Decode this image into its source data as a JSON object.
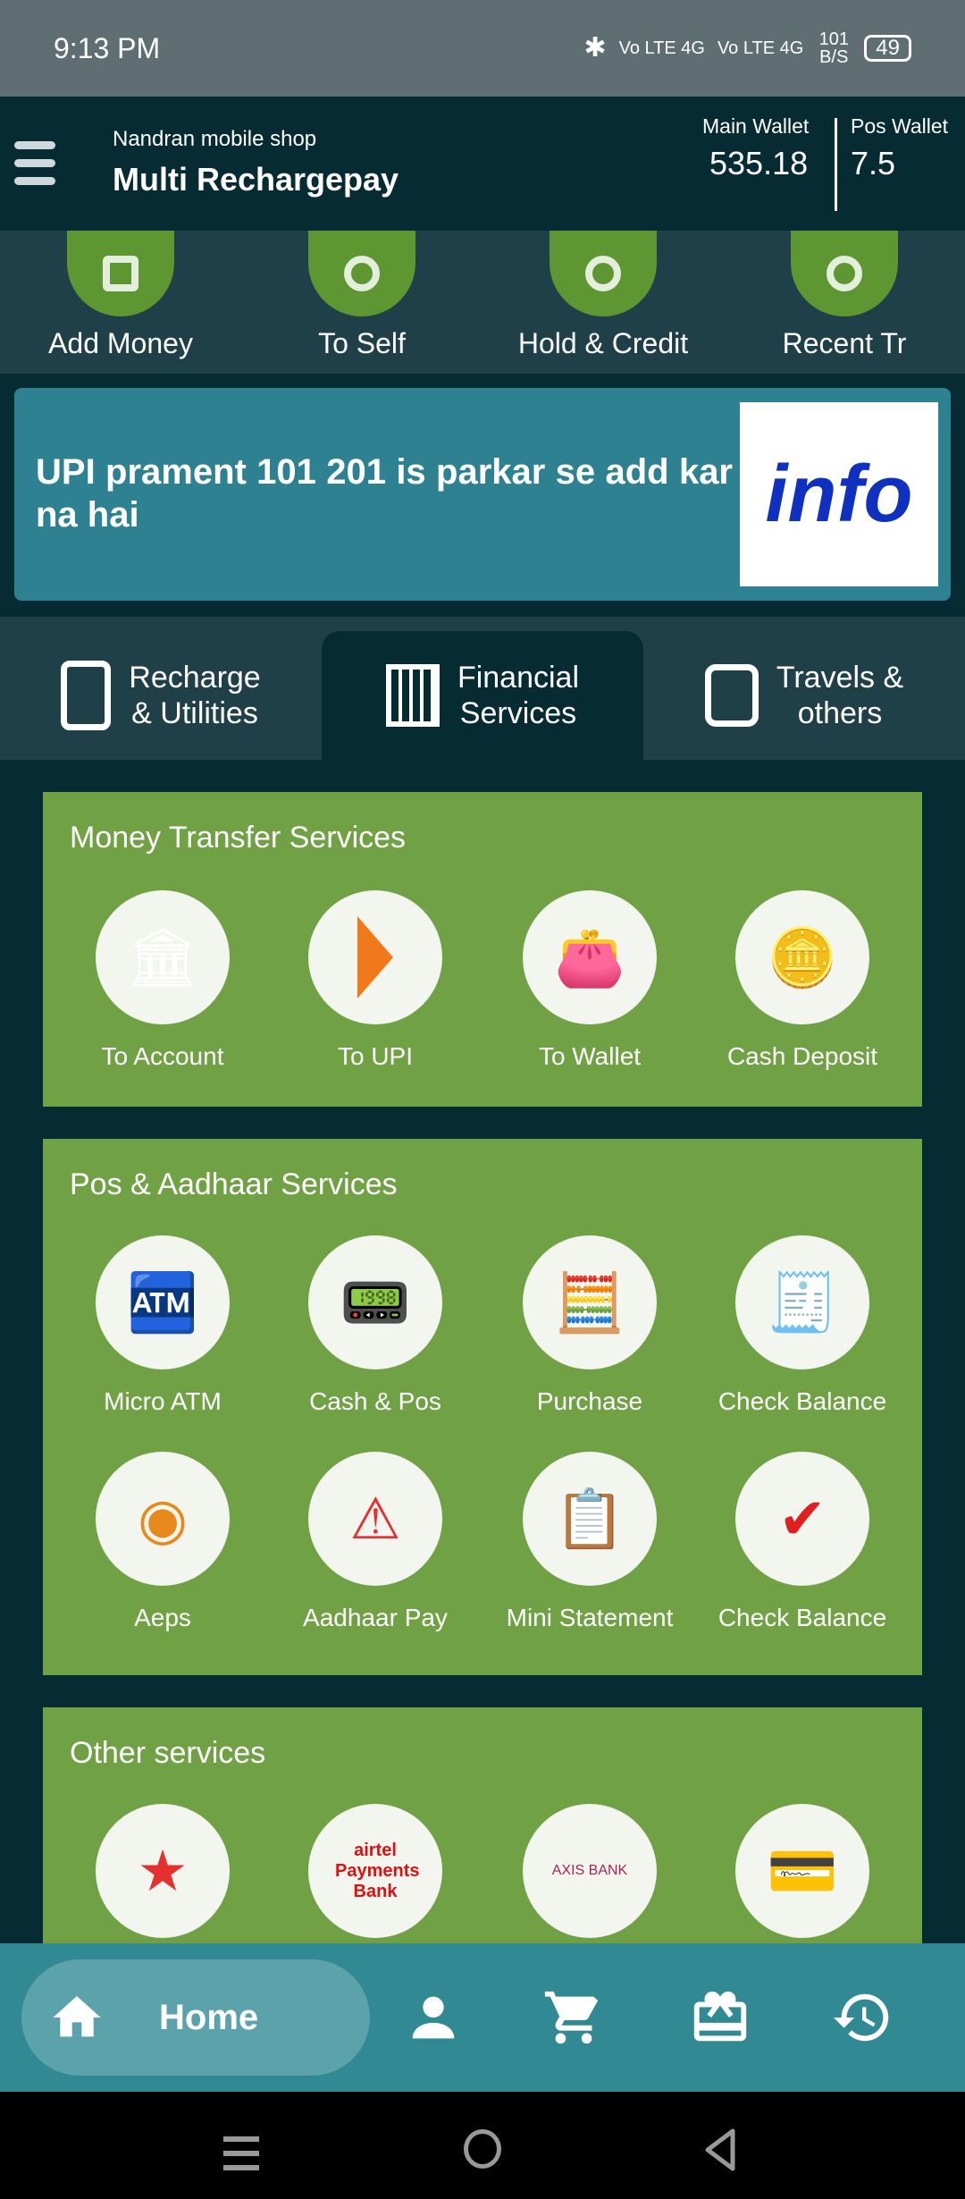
{
  "status": {
    "time": "9:13 PM",
    "net1": "Vo LTE 4G",
    "net2": "Vo LTE 4G",
    "speed": "101 B/S",
    "battery": "49"
  },
  "header": {
    "shop": "Nandran mobile shop",
    "app": "Multi Rechargepay",
    "main_wallet_label": "Main Wallet",
    "main_wallet": "535.18",
    "pos_wallet_label": "Pos Wallet",
    "pos_wallet": "7.5"
  },
  "quick": [
    {
      "label": "Add Money"
    },
    {
      "label": "To Self"
    },
    {
      "label": "Hold & Credit"
    },
    {
      "label": "Recent Tr"
    }
  ],
  "banner": {
    "text": "UPI prament 101 201 is parkar se add kar na hai",
    "image_text": "info"
  },
  "tabs": [
    {
      "l1": "Recharge",
      "l2": "& Utilities"
    },
    {
      "l1": "Financial",
      "l2": "Services",
      "active": true
    },
    {
      "l1": "Travels &",
      "l2": "others"
    }
  ],
  "money_transfer": {
    "title": "Money Transfer Services",
    "items": [
      "To Account",
      "To UPI",
      "To Wallet",
      "Cash Deposit"
    ]
  },
  "pos": {
    "title": "Pos & Aadhaar Services",
    "items": [
      "Micro ATM",
      "Cash & Pos",
      "Purchase",
      "Check Balance",
      "Aeps",
      "Aadhaar Pay",
      "Mini Statement",
      "Check Balance"
    ]
  },
  "other": {
    "title": "Other services",
    "logos": [
      "airtel Payments Bank",
      "AXIS BANK"
    ]
  },
  "bottom_nav": {
    "home": "Home",
    "icons": [
      "home-icon",
      "person-icon",
      "cart-icon",
      "gift-card-icon",
      "history-icon"
    ]
  },
  "colors": {
    "primary": "#062b33",
    "green": "#70a144",
    "teal": "#318a93"
  }
}
